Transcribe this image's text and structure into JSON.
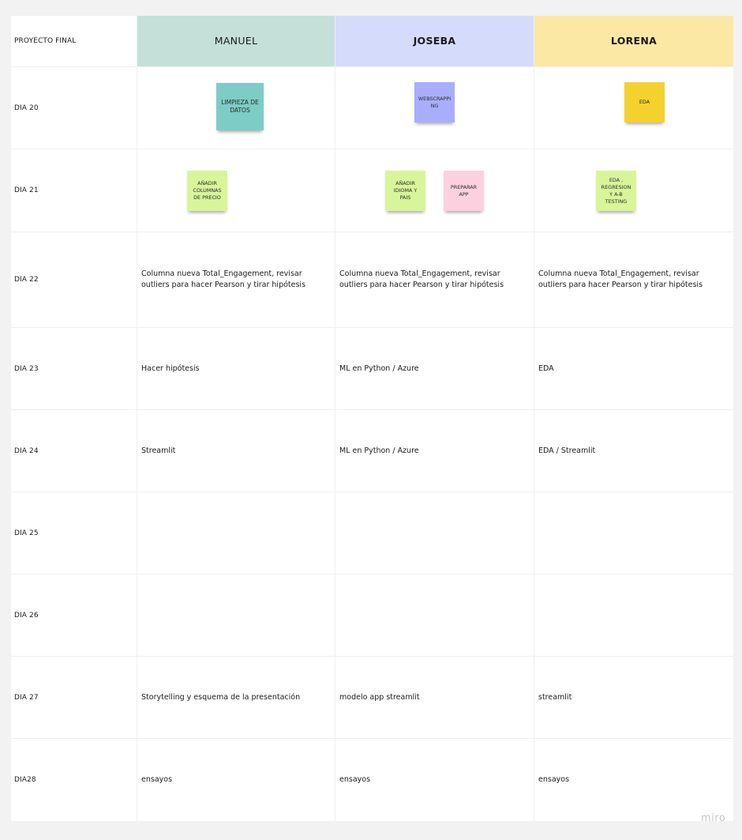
{
  "board": {
    "corner_label": "PROYECTO FINAL",
    "columns": [
      {
        "name": "MANUEL",
        "color": "#c5e0d9"
      },
      {
        "name": "JOSEBA",
        "color": "#d5dbfb"
      },
      {
        "name": "LORENA",
        "color": "#fbe8a5"
      }
    ],
    "rows": [
      {
        "label": "DIA 20",
        "cells": [
          "",
          "",
          ""
        ]
      },
      {
        "label": "DIA 21",
        "cells": [
          "",
          "",
          ""
        ]
      },
      {
        "label": "DIA 22",
        "cells": [
          "Columna nueva Total_Engagement, revisar outliers para hacer Pearson y tirar hipótesis",
          "Columna nueva Total_Engagement, revisar outliers para hacer Pearson y tirar hipótesis",
          "Columna nueva Total_Engagement, revisar outliers para hacer Pearson y tirar hipótesis"
        ]
      },
      {
        "label": "DIA 23",
        "cells": [
          "Hacer hipótesis",
          "ML en Python / Azure",
          "EDA"
        ]
      },
      {
        "label": "DIA 24",
        "cells": [
          "Streamlit",
          "ML en Python / Azure",
          "EDA / Streamlit"
        ]
      },
      {
        "label": "DIA 25",
        "cells": [
          "",
          "",
          ""
        ]
      },
      {
        "label": "DIA 26",
        "cells": [
          "",
          "",
          ""
        ]
      },
      {
        "label": "DIA 27",
        "cells": [
          "Storytelling y esquema de la presentación",
          "modelo app streamlit",
          "streamlit"
        ]
      },
      {
        "label": "DIA28",
        "cells": [
          "ensayos",
          "ensayos",
          "ensayos"
        ]
      }
    ]
  },
  "stickies": {
    "limpieza": {
      "text": "LIMPIEZA DE DATOS",
      "color": "#7dccc5"
    },
    "webscrapping": {
      "text": "WEBSCRAPPING",
      "color": "#a9aefc"
    },
    "eda_lorena": {
      "text": "EDA",
      "color": "#f5d12e"
    },
    "anadir_columnas": {
      "text": "AÑADIR COLUMNAS DE PRECIO",
      "color": "#d8f59a"
    },
    "anadir_idioma": {
      "text": "AÑADIR IDIOMA Y PAIS",
      "color": "#d8f59a"
    },
    "preparar_app": {
      "text": "PREPARAR APP",
      "color": "#fdd0df"
    },
    "eda_regresion": {
      "text": "EDA , REGRESION Y A-B TESTING",
      "color": "#d8f59a"
    }
  },
  "watermark": "miro"
}
